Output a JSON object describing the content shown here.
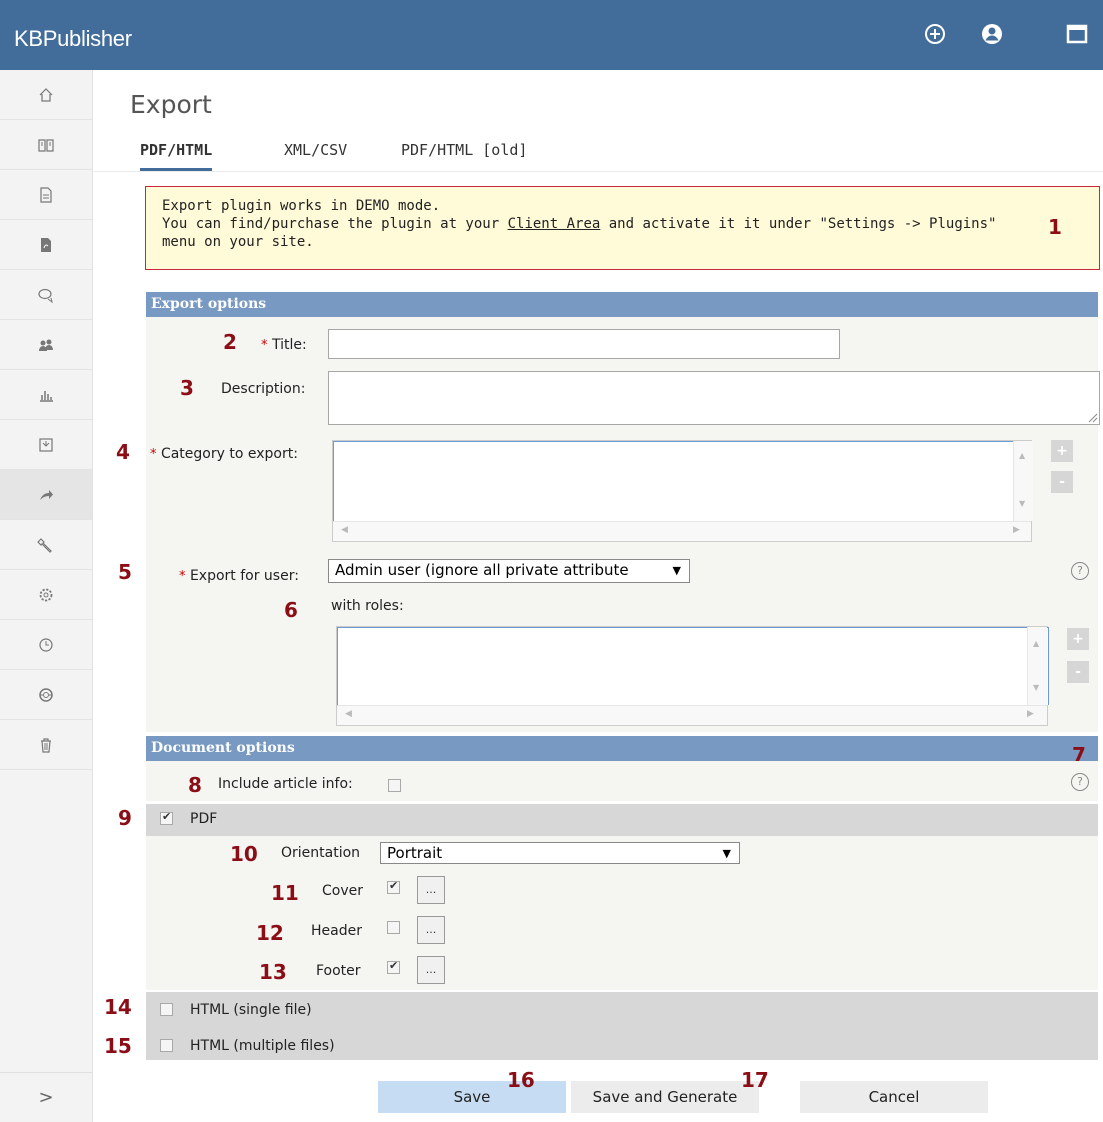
{
  "app": {
    "title": "KBPublisher"
  },
  "page": {
    "title": "Export",
    "tabs": [
      "PDF/HTML",
      "XML/CSV",
      "PDF/HTML [old]"
    ],
    "active_tab": "PDF/HTML"
  },
  "notice": {
    "line1": "Export plugin works in DEMO mode.",
    "line2_pre": "You can find/purchase the plugin at your",
    "link": "Client Area",
    "line2_post": "and activate it it under \"Settings -> Plugins\"",
    "line3": "menu on your site."
  },
  "export_options": {
    "heading": "Export options",
    "required_mark": "*",
    "title_label": "Title:",
    "title_value": "",
    "description_label": "Description:",
    "description_value": "",
    "category_label": "Category to export:",
    "user_label": "Export for user:",
    "user_value": "Admin user (ignore all private attribute",
    "roles_label": "with roles:",
    "plus": "+",
    "minus": "-",
    "help": "?"
  },
  "document_options": {
    "heading": "Document options",
    "include_info_label": "Include article info:",
    "include_info_checked": false,
    "pdf_label": "PDF",
    "pdf_checked": true,
    "orientation_label": "Orientation",
    "orientation_value": "Portrait",
    "cover_label": "Cover",
    "cover_checked": true,
    "header_label": "Header",
    "header_checked": false,
    "footer_label": "Footer",
    "footer_checked": true,
    "dots": "...",
    "html_single_label": "HTML (single file)",
    "html_multiple_label": "HTML (multiple files)"
  },
  "buttons": {
    "save": "Save",
    "save_generate": "Save and Generate",
    "cancel": "Cancel"
  },
  "callouts": [
    "1",
    "2",
    "3",
    "4",
    "5",
    "6",
    "7",
    "8",
    "9",
    "10",
    "11",
    "12",
    "13",
    "14",
    "15",
    "16",
    "17"
  ],
  "sidebar": {
    "icons": [
      "home-icon",
      "book-icon",
      "file-icon",
      "pdf-file-icon",
      "comments-icon",
      "users-icon",
      "stats-icon",
      "import-icon",
      "export-icon",
      "tools-icon",
      "settings-icon",
      "history-icon",
      "help-icon",
      "trash-icon"
    ],
    "expand": ">"
  },
  "colors": {
    "topbar": "#426d9b",
    "section_header": "#7899c1",
    "callout": "#8b0e17",
    "notice_border": "#c9273b",
    "notice_bg": "#fffbd9",
    "save_button": "#c5dcf2"
  }
}
